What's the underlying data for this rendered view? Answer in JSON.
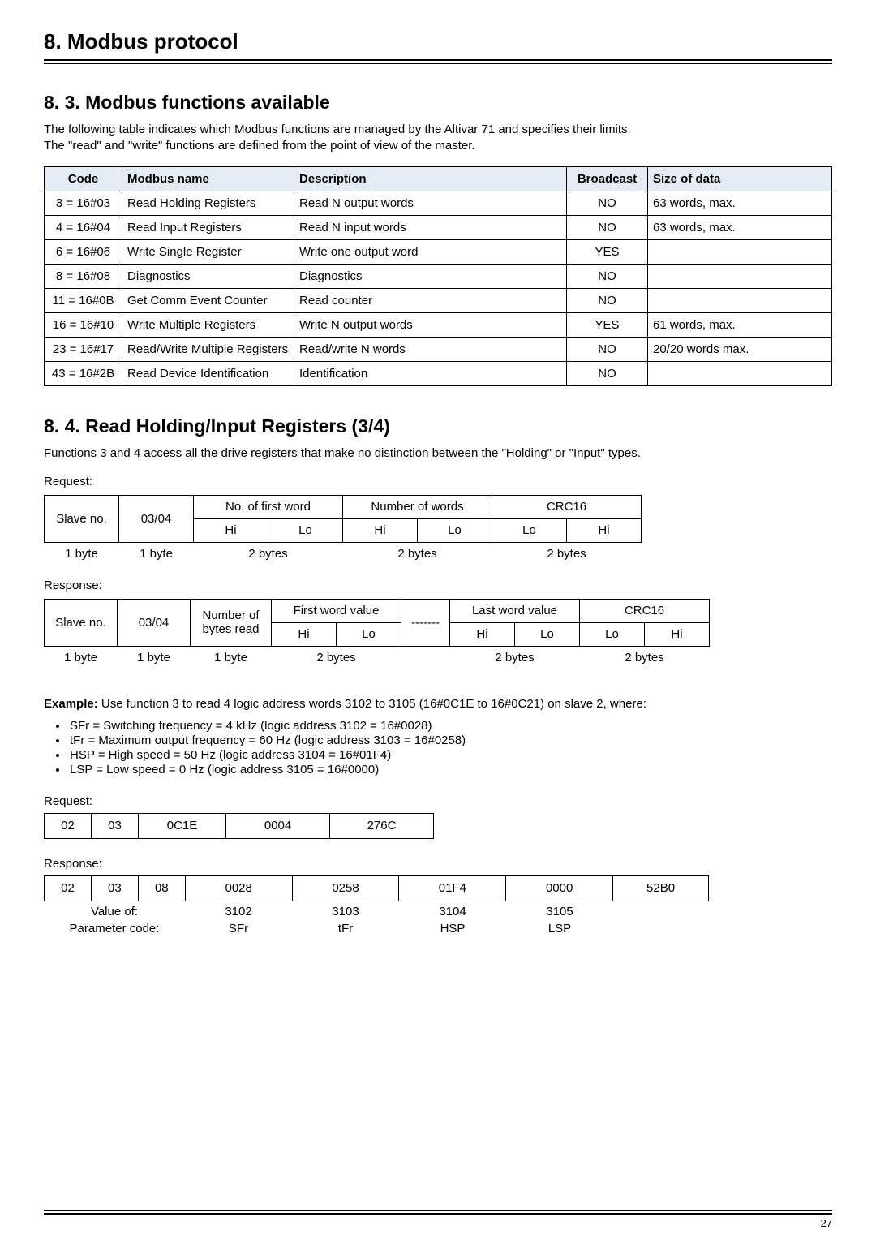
{
  "header": {
    "title": "8. Modbus protocol"
  },
  "sec83": {
    "title": "8. 3. Modbus functions available",
    "intro_l1": "The following table indicates which Modbus functions are managed by the Altivar 71 and specifies their limits.",
    "intro_l2": "The \"read\" and \"write\" functions are defined from the point of view of the master.",
    "th": {
      "code": "Code",
      "name": "Modbus name",
      "desc": "Description",
      "bc": "Broadcast",
      "size": "Size of data"
    },
    "rows": [
      {
        "code": "3 = 16#03",
        "name": "Read Holding Registers",
        "desc": "Read N output words",
        "bc": "NO",
        "size": "63 words, max."
      },
      {
        "code": "4 = 16#04",
        "name": "Read Input Registers",
        "desc": "Read N input words",
        "bc": "NO",
        "size": "63 words, max."
      },
      {
        "code": "6 = 16#06",
        "name": "Write Single Register",
        "desc": "Write one output word",
        "bc": "YES",
        "size": ""
      },
      {
        "code": "8 = 16#08",
        "name": "Diagnostics",
        "desc": "Diagnostics",
        "bc": "NO",
        "size": ""
      },
      {
        "code": "11 = 16#0B",
        "name": "Get Comm Event Counter",
        "desc": "Read counter",
        "bc": "NO",
        "size": ""
      },
      {
        "code": "16 = 16#10",
        "name": "Write Multiple Registers",
        "desc": "Write N output words",
        "bc": "YES",
        "size": "61 words, max."
      },
      {
        "code": "23 = 16#17",
        "name": "Read/Write Multiple Registers",
        "desc": "Read/write N words",
        "bc": "NO",
        "size": "20/20 words max."
      },
      {
        "code": "43 = 16#2B",
        "name": "Read Device Identification",
        "desc": "Identification",
        "bc": "NO",
        "size": ""
      }
    ]
  },
  "sec84": {
    "title": "8. 4. Read Holding/Input Registers (3/4)",
    "intro": "Functions 3 and 4 access all the drive registers that make no distinction between the \"Holding\" or \"Input\" types.",
    "request_label": "Request:",
    "response_label": "Response:",
    "hi": "Hi",
    "lo": "Lo",
    "req": {
      "h1": "Slave no.",
      "h2": "03/04",
      "h3": "No. of first word",
      "h4": "Number of words",
      "h5": "CRC16",
      "s1": "1 byte",
      "s2": "1 byte",
      "s3": "2 bytes",
      "s4": "2 bytes",
      "s5": "2 bytes"
    },
    "resp": {
      "h1": "Slave no.",
      "h2": "03/04",
      "h3": "Number of bytes read",
      "h4": "First word value",
      "h5": "-------",
      "h6": "Last word value",
      "h7": "CRC16",
      "s1": "1 byte",
      "s2": "1 byte",
      "s3": "1 byte",
      "s4": "2 bytes",
      "s5": "",
      "s6": "2 bytes",
      "s7": "2 bytes"
    }
  },
  "example": {
    "lead_bold": "Example:",
    "lead_rest": " Use function 3 to read 4 logic address words 3102 to 3105 (16#0C1E to 16#0C21) on slave 2, where:",
    "bullets": [
      "SFr = Switching frequency = 4 kHz (logic address 3102 = 16#0028)",
      "tFr = Maximum output frequency = 60 Hz (logic address 3103 = 16#0258)",
      "HSP = High speed = 50 Hz (logic address 3104 = 16#01F4)",
      "LSP = Low speed = 0 Hz (logic address 3105 = 16#0000)"
    ],
    "req_label": "Request:",
    "req_cells": [
      "02",
      "03",
      "0C1E",
      "0004",
      "276C"
    ],
    "resp_label": "Response:",
    "resp_cells": [
      "02",
      "03",
      "08",
      "0028",
      "0258",
      "01F4",
      "0000",
      "52B0"
    ],
    "value_of_label": "Value of:",
    "value_of": [
      "3102",
      "3103",
      "3104",
      "3105"
    ],
    "param_label": "Parameter code:",
    "param": [
      "SFr",
      "tFr",
      "HSP",
      "LSP"
    ]
  },
  "pagenum": "27"
}
